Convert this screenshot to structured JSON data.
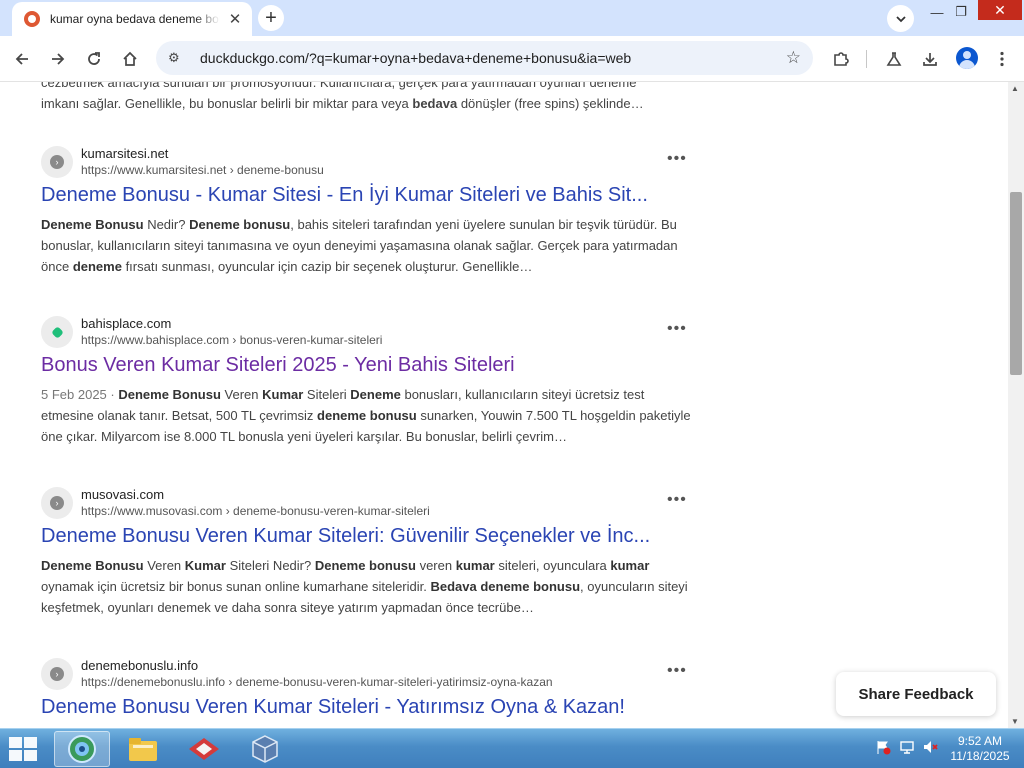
{
  "browser": {
    "tab_title": "kumar oyna bedava deneme bonusu",
    "tab_close": "✕",
    "new_tab": "+",
    "url": "duckduckgo.com/?q=kumar+oyna+bedava+deneme+bonusu&ia=web",
    "window_controls": {
      "minimize": "—",
      "restore": "❐",
      "close": "✕"
    }
  },
  "top_snippet": {
    "line1": "cezbetmek amacıyla sunulan bir promosyondur. Kullanıcılara, gerçek para yatırmadan oyunları deneme",
    "line2_pre": "imkanı sağlar. Genellikle, bu bonuslar belirli bir miktar para veya ",
    "line2_bold": "bedava",
    "line2_post": " dönüşler (free spins) şeklinde…"
  },
  "results": [
    {
      "site_name": "kumarsitesi.net",
      "site_url": "https://www.kumarsitesi.net › deneme-bonusu",
      "title": "Deneme Bonusu - Kumar Sitesi - En İyi Kumar Siteleri ve Bahis Sit...",
      "s": [
        "Deneme Bonusu",
        " Nedir? ",
        "Deneme bonusu",
        ", bahis siteleri tarafından yeni üyelere sunulan bir teşvik türüdür. Bu bonuslar, kullanıcıların siteyi tanımasına ve oyun deneyimi yaşamasına olanak sağlar. Gerçek para yatırmadan önce ",
        "deneme",
        " fırsatı sunması, oyuncular için cazip bir seçenek oluşturur. Genellikle…"
      ]
    },
    {
      "site_name": "bahisplace.com",
      "site_url": "https://www.bahisplace.com › bonus-veren-kumar-siteleri",
      "title": "Bonus Veren Kumar Siteleri 2025 - Yeni Bahis Siteleri",
      "date": "5 Feb 2025",
      "s": [
        "Deneme Bonusu",
        " Veren ",
        "Kumar",
        " Siteleri ",
        "Deneme",
        " bonusları, kullanıcıların siteyi ücretsiz test etmesine olanak tanır. Betsat, 500 TL çevrimsiz ",
        "deneme bonusu",
        " sunarken, Youwin 7.500 TL hoşgeldin paketiyle öne çıkar. Milyarcom ise 8.000 TL bonusla yeni üyeleri karşılar. Bu bonuslar, belirli çevrim…"
      ]
    },
    {
      "site_name": "musovasi.com",
      "site_url": "https://www.musovasi.com › deneme-bonusu-veren-kumar-siteleri",
      "title": "Deneme Bonusu Veren Kumar Siteleri: Güvenilir Seçenekler ve İnc...",
      "s": [
        "Deneme Bonusu",
        " Veren ",
        "Kumar",
        " Siteleri Nedir? ",
        "Deneme bonusu",
        " veren ",
        "kumar",
        " siteleri, oyunculara ",
        "kumar",
        " oynamak için ücretsiz bir bonus sunan online kumarhane siteleridir. ",
        "Bedava deneme bonusu",
        ", oyuncuların siteyi keşfetmek, oyunları denemek ve daha sonra siteye yatırım yapmadan önce tecrübe…"
      ]
    },
    {
      "site_name": "denemebonuslu.info",
      "site_url": "https://denemebonuslu.info › deneme-bonusu-veren-kumar-siteleri-yatirimsiz-oyna-kazan",
      "title": "Deneme Bonusu Veren Kumar Siteleri - Yatırımsız Oyna & Kazan!"
    }
  ],
  "more_label": "•••",
  "feedback_label": "Share Feedback",
  "taskbar": {
    "time": "9:52 AM",
    "date": "11/18/2025"
  }
}
